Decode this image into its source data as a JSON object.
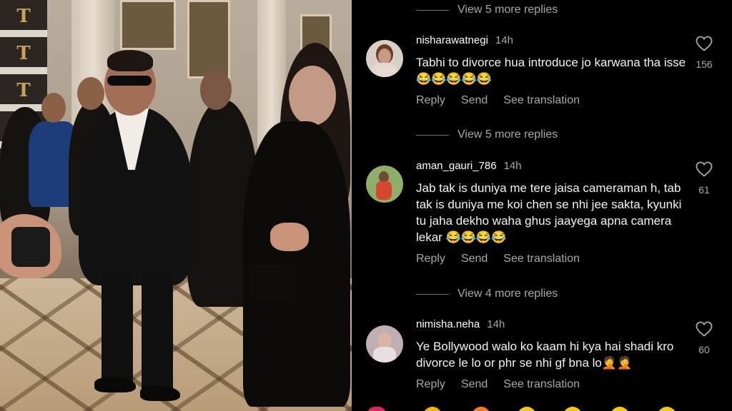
{
  "photo": {
    "banner_letter": "T"
  },
  "comments_panel": {
    "threads": [
      {
        "view_more": "View 5 more replies"
      },
      {
        "username": "nisharawatnegi",
        "time": "14h",
        "text": "Tabhi to divorce hua introduce jo karwana tha isse 😂😂😂😂😂",
        "likes": "156",
        "actions": {
          "reply": "Reply",
          "send": "Send",
          "translate": "See translation"
        },
        "view_more_after": "View 5 more replies"
      },
      {
        "username": "aman_gauri_786",
        "time": "14h",
        "text": "Jab tak is duniya me tere jaisa cameraman h, tab tak is duniya me koi chen se nhi jee sakta, kyunki tu jaha dekho waha ghus jaayega apna camera lekar 😂😂😂😂",
        "likes": "61",
        "actions": {
          "reply": "Reply",
          "send": "Send",
          "translate": "See translation"
        },
        "view_more_after": "View 4 more replies"
      },
      {
        "username": "nimisha.neha",
        "time": "14h",
        "text": "Ye Bollywood walo ko kaam hi kya hai shadi kro divorce le lo or phr se nhi gf bna lo🤦🤦",
        "likes": "60",
        "actions": {
          "reply": "Reply",
          "send": "Send",
          "translate": "See translation"
        }
      }
    ]
  },
  "icons": {
    "like": "heart-outline-icon"
  },
  "colors": {
    "background": "#000000",
    "text": "#f3f3f3",
    "secondary_text": "#a8a8a8"
  }
}
